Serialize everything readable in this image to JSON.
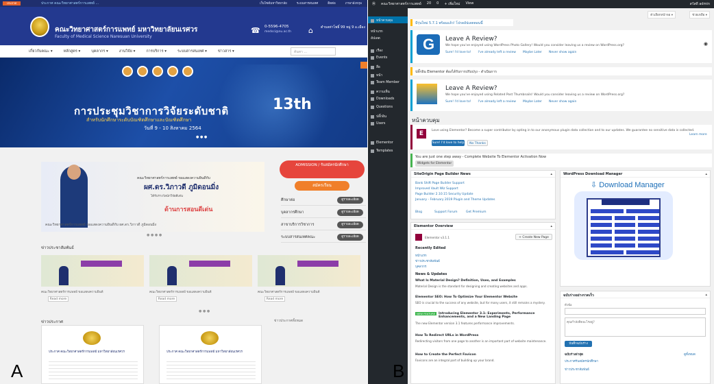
{
  "panel_labels": {
    "a": "A",
    "b": "B"
  },
  "panel_a": {
    "topbar": {
      "badge": "ประกาศ",
      "announcement": "ประกาศ คณะวิทยาศาสตร์การแพทย์ ...",
      "links": [
        "เว็บไซต์มหาวิทยาลัย",
        "ระบบสารสนเทศ",
        "ติดต่อ",
        "ภาษาอังกฤษ"
      ]
    },
    "header": {
      "title": "คณะวิทยาศาสตร์การแพทย์ มหาวิทยาลัยนเรศวร",
      "subtitle": "Faculty of Medical Science Naresuan University",
      "phone": "0-5596-4705",
      "phone_sub": "medsci@nu.ac.th",
      "address": "ตำบลท่าโพธิ์ 99 หมู่ 9 อ.เมือง"
    },
    "nav": {
      "items": [
        "เกี่ยวกับคณะ ▾",
        "หลักสูตร ▾",
        "บุคลากร ▾",
        "งานวิจัย ▾",
        "การบริการ ▾",
        "ระบบสารสนเทศ ▾",
        "ข่าวสาร ▾"
      ],
      "search_placeholder": "ค้นหา ..."
    },
    "hero": {
      "headline": "การประชุมวิชาการวิจัยระดับชาติ",
      "edition": "13th",
      "subline": "สำหรับนักศึกษาระดับบัณฑิตศึกษาและบัณฑิตศึกษา",
      "dates": "วันที่ 9 - 10 สิงหาคม 2564",
      "dots": "● ● ●"
    },
    "news": {
      "line1": "คณะวิทยาศาสตร์การแพทย์ ขอแสดงความยินดีกับ",
      "name": "ผศ.ดร.วิภาวดี ภูมิดอนมิ่ง",
      "line3": "ได้รับรางวัลนักวิจัยดีเด่น",
      "award": "ด้านการสอนดีเด่น",
      "caption": "คณะวิทยาศาสตร์การแพทย์ ขอแสดงความยินดีกับ ผศ.ดร.วิภาวดี ภูมิดอนมิ่ง",
      "dots": "● ● ● ●"
    },
    "sidebar": {
      "admission": "ADMISSION / รับสมัครนักศึกษา",
      "apply": "สมัครเรียน",
      "rows": [
        {
          "label": "ศึกษาต่อ",
          "pill": "ดูรายละเอียด"
        },
        {
          "label": "บุคลากรศึกษา",
          "pill": "ดูรายละเอียด"
        },
        {
          "label": "สาขาบริการวิชาการ",
          "pill": "ดูรายละเอียด"
        },
        {
          "label": "ระบบสารสนเทศคณะ",
          "pill": "ดูรายละเอียด"
        }
      ]
    },
    "section1": "ข่าวประชาสัมพันธ์",
    "cards": [
      {
        "caption": "คณะวิทยาศาสตร์การแพทย์ ขอแสดงความยินดี",
        "button": "Read more"
      },
      {
        "caption": "คณะวิทยาศาสตร์การแพทย์ ขอแสดงความยินดี",
        "button": "Read more"
      },
      {
        "caption": "คณะวิทยาศาสตร์การแพทย์ ขอแสดงความยินดี",
        "button": "Read more"
      }
    ],
    "cards_dots": "● ● ●",
    "section2": "ข่าวประกาศ",
    "section2_right": "ข่าวประกาศทั้งหมด",
    "docs": [
      {
        "title": "ประกาศ คณะวิทยาศาสตร์การแพทย์ มหาวิทยาลัยนเรศวร"
      },
      {
        "title": "ประกาศ คณะวิทยาศาสตร์การแพทย์ มหาวิทยาลัยนเรศวร"
      }
    ]
  },
  "panel_b": {
    "adminbar": {
      "site": [
        "คณะวิทยาศาสตร์การแพทย์",
        "20",
        "0",
        "+ เพิ่มใหม่",
        "View"
      ],
      "user": "สวัสดี admin"
    },
    "screen_options": [
      "ตัวเลือกหน้าจอ ▾",
      "ช่วยเหลือ ▾"
    ],
    "sidebar": {
      "active": "หน้าควบคุม",
      "items": [
        "หน้าแรก",
        "อัปเดต",
        "เรื่อง",
        "Events",
        "สื่อ",
        "หน้า",
        "Team Member",
        "ความเห็น",
        "Downloads",
        "Questions",
        "ปลั๊กอิน",
        "Users",
        "Elementor",
        "Templates"
      ]
    },
    "notice1": "มีรุ่นใหม่ 5.7.1 พร้อมแล้ว! โปรดอัปเดตตอนนี้",
    "review1": {
      "heading": "Leave A Review?",
      "desc": "We hope you've enjoyed using WordPress Photo Gallery! Would you consider leaving us a review on WordPress.org?",
      "links": [
        "Sure! I'd love to!",
        "I've already left a review",
        "Maybe Later",
        "Never show again"
      ]
    },
    "notice2": "ปลั๊กอิน Elementor ต้องได้รับการปรับปรุง - ดำเนินการ",
    "review2": {
      "heading": "Leave A Review?",
      "desc": "We hope you've enjoyed using Related Post Thumbnails! Would you consider leaving us a review on WordPress.org?",
      "links": [
        "Sure! I'd love to!",
        "I've already left a review",
        "Maybe Later",
        "Never show again"
      ]
    },
    "dashboard_title": "หน้าควบคุม",
    "elementor_note": {
      "text": "Love using Elementor? Become a super contributor by opting in to our anonymous plugin data collection and to our updates. We guarantee no sensitive data is collected.",
      "learn": "Learn more",
      "btn_yes": "Sure! I'd love to help",
      "btn_no": "No Thanks"
    },
    "info_bar": "You are just one step away - Complete Website To Elementor Activation Now",
    "info_btn": "Widgets for Elementor",
    "site_origin": {
      "title": "SiteOrigin Page Builder News",
      "items": [
        "Bank Shift Page Builder Support",
        "Improved Vault Wiz Support",
        "Page Builder 2.10.15 Security Update",
        "January - February 2019 Plugin and Theme Updates"
      ],
      "footer": [
        "Blog",
        "Support Forum",
        "Get Premium"
      ]
    },
    "elementor_overview": {
      "title": "Elementor Overview",
      "version": "Elementor v3.1.1",
      "create": "+ Create New Page",
      "recent_title": "Recently Edited",
      "recent": [
        "หน้าแรก",
        "ข่าวประชาสัมพันธ์",
        "บุคลากร"
      ],
      "news_title": "News & Updates",
      "news": [
        {
          "h": "What Is Material Design? Definition, Uses, and Examples",
          "d": "Material Design is the standard for designing and creating websites and apps."
        },
        {
          "h": "Elementor SEO: How To Optimize Your Elementor Website",
          "d": "SEO is crucial to the success of any website, but for many users, it still remains a mystery."
        },
        {
          "h": "Introducing Elementor 3.1: Experiments, Performance Enhancements, and a New Landing Page",
          "d": "The new Elementor version 3.1 features performance improvements."
        },
        {
          "h": "How To Redirect URLs in WordPress",
          "d": "Redirecting visitors from one page to another is an important part of website maintenance."
        },
        {
          "h": "How to Create the Perfect Favicon",
          "d": "Favicons are an integral part of building up your brand."
        }
      ],
      "new_badge": "NEW FEATURE"
    },
    "download_manager": {
      "title": "WordPress Download Manager",
      "brand": "Download Manager"
    },
    "quick_draft": {
      "title": "ฉบับร่างอย่างรวดเร็ว",
      "label_title": "หัวข้อ",
      "content_placeholder": "คุณกำลังคิดอะไรอยู่?",
      "save": "บันทึกฉบับร่าง",
      "drafts": "ฉบับร่างล่าสุด",
      "drafts_all": "ดูทั้งหมด",
      "draft_items": [
        "ประกาศรับสมัครนักศึกษา",
        "ข่าวประชาสัมพันธ์"
      ]
    }
  }
}
